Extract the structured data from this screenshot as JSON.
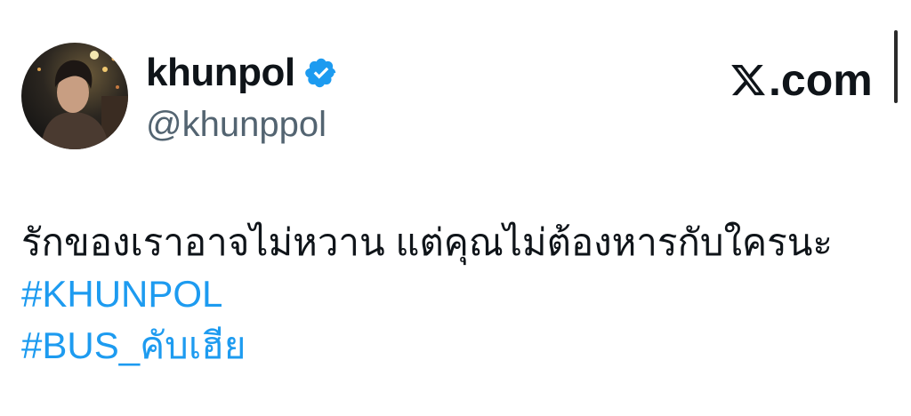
{
  "brand": {
    "logo_icon": "x-logo-icon",
    "text": ".com"
  },
  "author": {
    "display_name": "khunpol",
    "handle": "@khunppol",
    "verified_icon": "verified-badge-icon",
    "verified_color": "#1d9bf0",
    "avatar_icon": "profile-photo"
  },
  "tweet": {
    "text": "รักของเราอาจไม่หวาน แต่คุณไม่ต้องหารกับใครนะ",
    "hashtags": [
      "#KHUNPOL",
      "#BUS_คับเฮีย"
    ],
    "hashtag_color": "#1d9bf0"
  }
}
